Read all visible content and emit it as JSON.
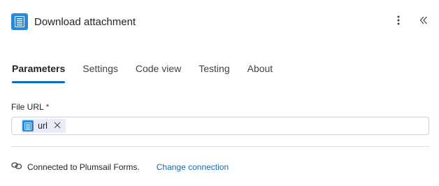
{
  "header": {
    "title": "Download attachment",
    "app_icon": "list-icon",
    "more_icon": "more-vertical-icon",
    "collapse_icon": "double-chevron-left-icon",
    "accent": "#2b88d8"
  },
  "tabs": [
    {
      "label": "Parameters",
      "active": true
    },
    {
      "label": "Settings",
      "active": false
    },
    {
      "label": "Code view",
      "active": false
    },
    {
      "label": "Testing",
      "active": false
    },
    {
      "label": "About",
      "active": false
    }
  ],
  "field": {
    "label": "File URL",
    "required_mark": "*",
    "token": {
      "label": "url",
      "icon": "list-icon",
      "remove_icon": "close-icon"
    }
  },
  "connection": {
    "icon": "link-icon",
    "text": "Connected to Plumsail Forms.",
    "change_label": "Change connection",
    "link_color": "#0f6cbd"
  }
}
